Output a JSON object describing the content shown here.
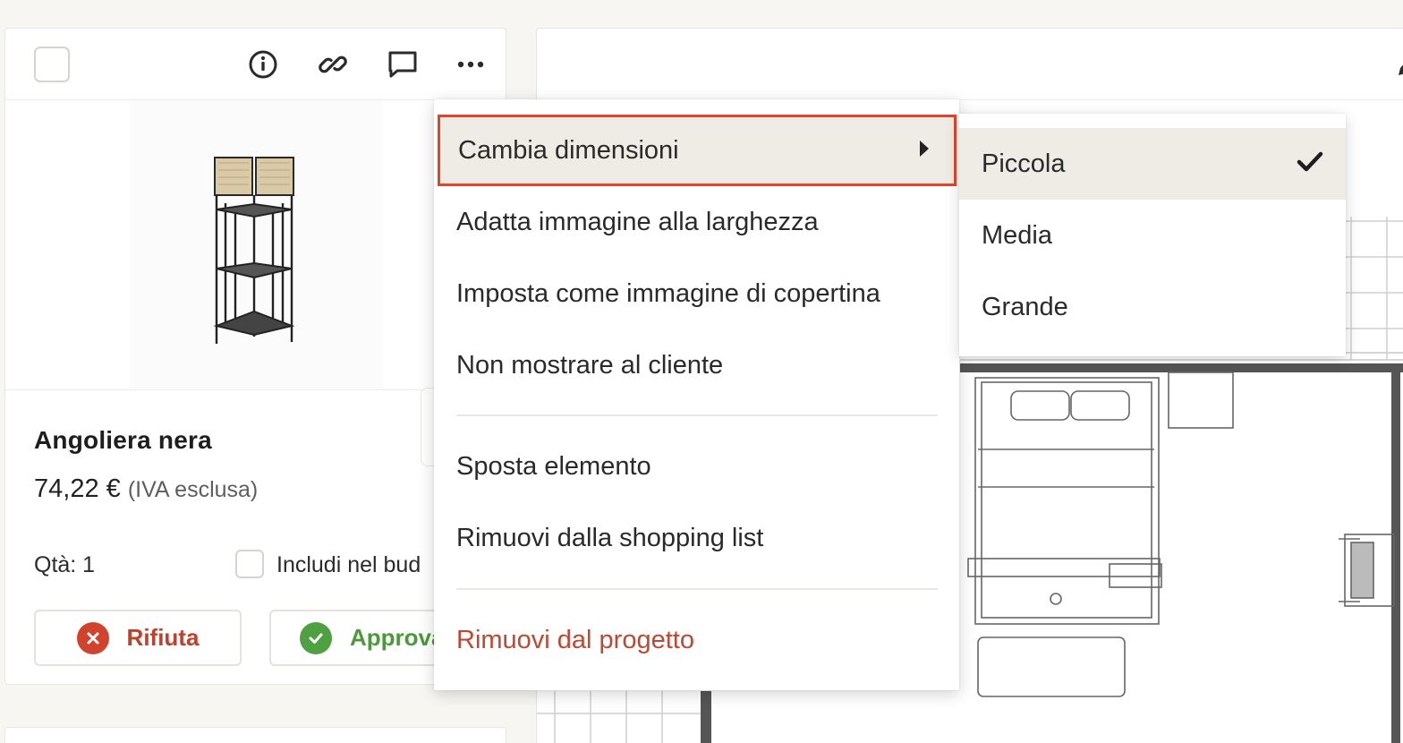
{
  "card": {
    "header_icons": [
      "info-icon",
      "link-icon",
      "comment-icon",
      "more-icon"
    ],
    "product_name": "Angoliera nera",
    "price": "74,22 €",
    "tax_note": "(IVA esclusa)",
    "quantity": "Qtà: 1",
    "budget_label": "Includi nel bud",
    "reject_label": "Rifiuta",
    "approve_label": "Approva"
  },
  "menu": {
    "items": [
      "Cambia dimensioni",
      "Adatta immagine alla larghezza",
      "Imposta come immagine di copertina",
      "Non mostrare al cliente",
      "Sposta elemento",
      "Rimuovi dalla shopping list",
      "Rimuovi dal progetto"
    ],
    "highlighted_index": 0
  },
  "submenu": {
    "items": [
      "Piccola",
      "Media",
      "Grande"
    ],
    "selected": "Piccola"
  },
  "colors": {
    "accent_red": "#e0452c",
    "danger_text": "#c24730",
    "approve_green": "#4a9a3a"
  }
}
